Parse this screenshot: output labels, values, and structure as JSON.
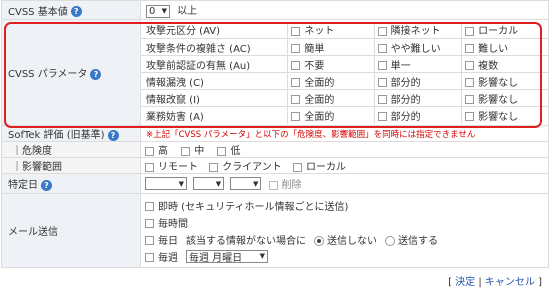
{
  "cvss_base": {
    "label": "CVSS 基本値",
    "select_value": "0",
    "suffix": "以上"
  },
  "cvss_params": {
    "label": "CVSS パラメータ",
    "rows": [
      {
        "name": "攻撃元区分 (AV)",
        "options": [
          "ネット",
          "隣接ネット",
          "ローカル"
        ]
      },
      {
        "name": "攻撃条件の複雑さ (AC)",
        "options": [
          "簡単",
          "やや難しい",
          "難しい"
        ]
      },
      {
        "name": "攻撃前認証の有無 (Au)",
        "options": [
          "不要",
          "単一",
          "複数"
        ]
      },
      {
        "name": "情報漏洩 (C)",
        "options": [
          "全面的",
          "部分的",
          "影響なし"
        ]
      },
      {
        "name": "情報改竄 (I)",
        "options": [
          "全面的",
          "部分的",
          "影響なし"
        ]
      },
      {
        "name": "業務妨害 (A)",
        "options": [
          "全面的",
          "部分的",
          "影響なし"
        ]
      }
    ]
  },
  "softek": {
    "label": "SofTek 評価 (旧基準)",
    "warning": "※上記「CVSS パラメータ」と以下の「危険度、影響範囲」を同時には指定できません",
    "danger_label": "｜危険度",
    "danger_options": [
      "高",
      "中",
      "低"
    ],
    "scope_label": "｜影響範囲",
    "scope_options": [
      "リモート",
      "クライアント",
      "ローカル"
    ]
  },
  "date": {
    "label": "特定日",
    "delete_label": "削除"
  },
  "mail": {
    "label": "メール送信",
    "immediate": "即時 (セキュリティホール情報ごとに送信)",
    "hourly": "毎時間",
    "daily": "毎日",
    "daily_note": "該当する情報がない場合に",
    "radio_no": "送信しない",
    "radio_yes": "送信する",
    "weekly": "毎週",
    "weekly_select": "毎週 月曜日"
  },
  "footer": {
    "open": "[",
    "confirm": "決定",
    "sep": "|",
    "cancel": "キャンセル",
    "close": "]"
  }
}
